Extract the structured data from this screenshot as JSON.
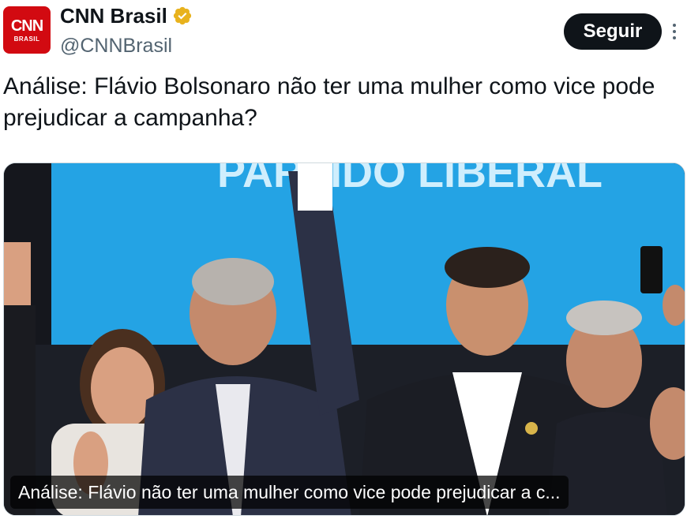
{
  "account": {
    "display_name": "CNN Brasil",
    "handle": "@CNNBrasil",
    "verified": true,
    "verified_badge_color": "#e8b21d",
    "avatar_logo": "CNN",
    "avatar_sub": "BRASIL",
    "avatar_color": "#d20a11"
  },
  "actions": {
    "follow_label": "Seguir",
    "more_icon": "more-vertical-icon"
  },
  "tweet": {
    "text": "Análise: Flávio Bolsonaro não ter uma mulher como vice pode prejudicar a campanha?"
  },
  "media": {
    "banner_text": "PARTIDO LIBERAL",
    "caption": "Análise: Flávio não ter uma mulher como vice pode prejudicar a c..."
  }
}
